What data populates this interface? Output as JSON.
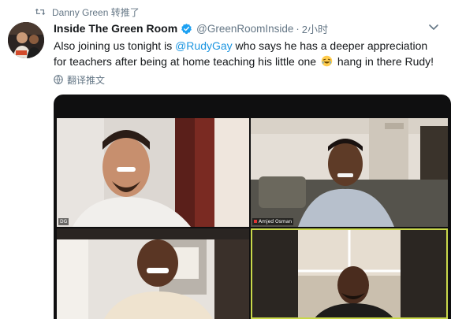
{
  "retweet": {
    "icon": "retweet-icon",
    "text": "Danny Green 转推了"
  },
  "tweet": {
    "avatar": "avatar",
    "display_name": "Inside The Green Room",
    "verified": true,
    "handle": "@GreenRoomInside",
    "separator": "·",
    "time": "2小时",
    "text_before": "Also joining us tonight is ",
    "mention": "@RudyGay",
    "text_after": " who says he has a deeper appreciation for teachers after being at home teaching his little one",
    "emoji": "😂",
    "text_end": " hang in there Rudy!",
    "translate_label": "翻译推文",
    "caret_icon": "chevron-down-icon"
  },
  "video_call": {
    "tiles": [
      {
        "label": "DG"
      },
      {
        "label": "Amjed Osman"
      },
      {
        "label": ""
      },
      {
        "label": ""
      }
    ]
  },
  "colors": {
    "link": "#1b95e0",
    "muted": "#657786",
    "text": "#14171a",
    "verified": "#1da1f2",
    "active_speaker_border": "#c9d84a"
  }
}
